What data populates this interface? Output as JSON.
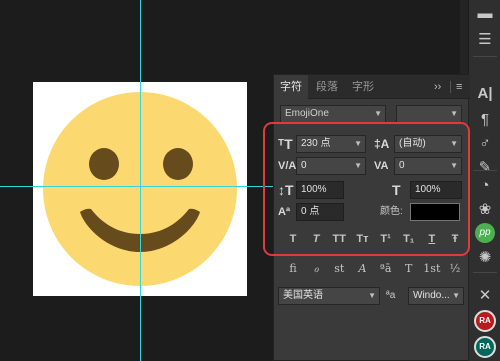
{
  "canvas": {
    "emoji": "smiling-face-emoji",
    "colors": {
      "face": "#fbd970",
      "features": "#664b1c",
      "guides": "#34d6dc",
      "highlight": "#e03a3a"
    }
  },
  "panel": {
    "tabs": [
      {
        "label": "字符",
        "active": true
      },
      {
        "label": "段落",
        "active": false
      },
      {
        "label": "字形",
        "active": false
      }
    ],
    "collapse_label": "››",
    "menu_label": "≡",
    "font_family": "EmojiOne",
    "font_size": "230 点",
    "leading": "(自动)",
    "kerning": "0",
    "tracking": "0",
    "vertical_scale": "100%",
    "horizontal_scale": "100%",
    "baseline_shift": "0 点",
    "color_label": "颜色:",
    "color_value": "#000000",
    "style_glyphs": [
      "T",
      "T",
      "TT",
      "Tт",
      "T¹",
      "T₁",
      "T",
      "Ŧ"
    ],
    "opentype_glyphs": [
      "fi",
      "ℴ",
      "st",
      "A",
      "ªā",
      "T",
      "1st",
      "½"
    ],
    "language": "美国英语",
    "aa_label": "ªa",
    "antialias": "Windo..."
  },
  "toolbar": {
    "icons": [
      "adjust-icon",
      "sliders-icon",
      "character-icon",
      "paragraph-icon",
      "glyphs-icon",
      "text-style-icon",
      "plugin-icon",
      "brush-icon",
      "pp-icon",
      "shutter-icon",
      "tools-icon",
      "ra-icon",
      "ra-icon"
    ],
    "labels": {
      "character": "A|",
      "paragraph": "¶",
      "pp": "pp",
      "ra": "RA"
    }
  }
}
